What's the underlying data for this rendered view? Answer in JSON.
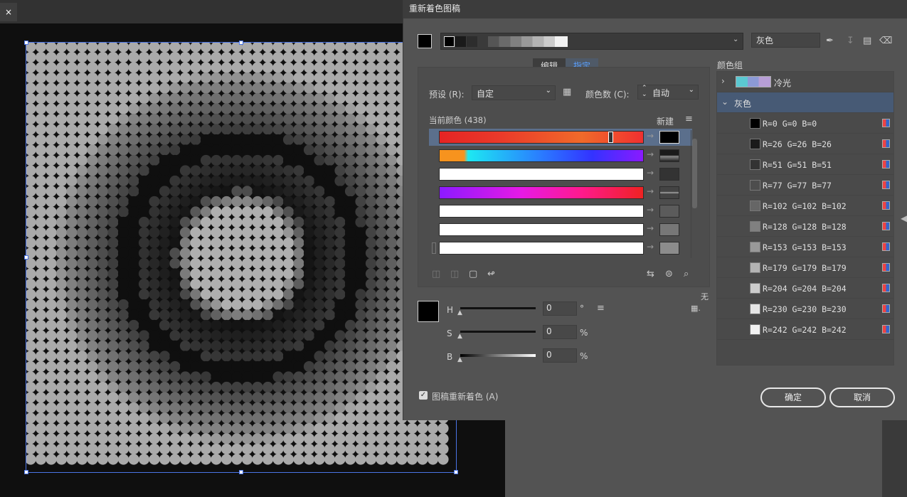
{
  "background": {
    "close_tab_label": "×"
  },
  "dialog": {
    "title": "重新着色图稿",
    "color_name": "灰色",
    "tabs": [
      "编辑",
      "指定"
    ],
    "preset_label": "预设 (R):",
    "preset_value": "自定",
    "color_count_label": "颜色数 (C):",
    "color_count_value": "自动",
    "current_colors_label": "当前颜色 (438)",
    "new_label": "新建",
    "none_label": "无",
    "h_label": "H",
    "h_value": "0",
    "h_unit": "°",
    "s_label": "S",
    "s_value": "0",
    "s_unit": "%",
    "b_label": "B",
    "b_value": "0",
    "b_unit": "%",
    "recolor_checkbox_label": "图稿重新着色 (A)",
    "ok_label": "确定",
    "cancel_label": "取消",
    "groups_label": "颜色组",
    "group_cool": "冷光",
    "group_gray": "灰色",
    "gray_colors": [
      {
        "label": "R=0 G=0 B=0",
        "hex": "#000000"
      },
      {
        "label": "R=26 G=26 B=26",
        "hex": "#1a1a1a"
      },
      {
        "label": "R=51 G=51 B=51",
        "hex": "#333333"
      },
      {
        "label": "R=77 G=77 B=77",
        "hex": "#4d4d4d"
      },
      {
        "label": "R=102 G=102 B=102",
        "hex": "#666666"
      },
      {
        "label": "R=128 G=128 B=128",
        "hex": "#808080"
      },
      {
        "label": "R=153 G=153 B=153",
        "hex": "#999999"
      },
      {
        "label": "R=179 G=179 B=179",
        "hex": "#b3b3b3"
      },
      {
        "label": "R=204 G=204 B=204",
        "hex": "#cccccc"
      },
      {
        "label": "R=230 G=230 B=230",
        "hex": "#e6e6e6"
      },
      {
        "label": "R=242 G=242 B=242",
        "hex": "#f2f2f2"
      }
    ],
    "accent": "#5aa0ff"
  }
}
